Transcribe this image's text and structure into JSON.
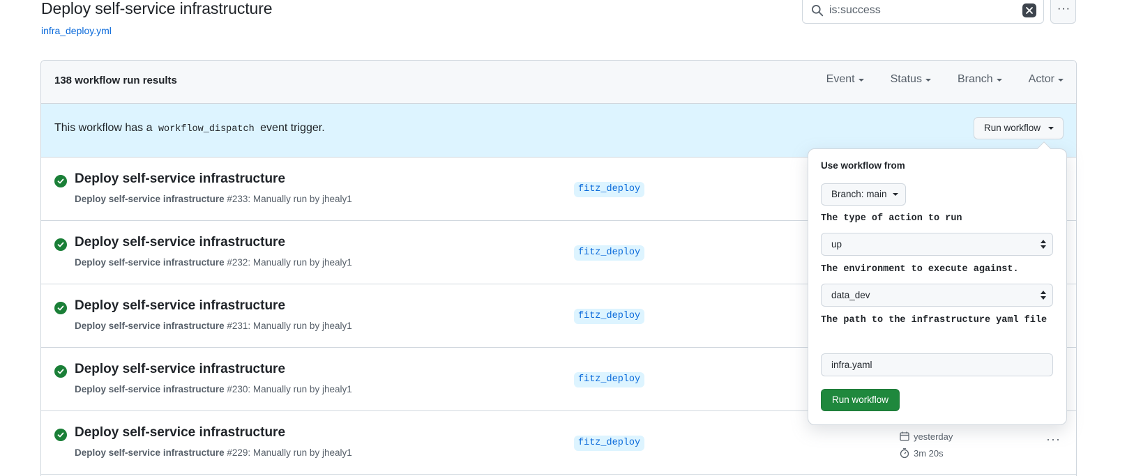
{
  "header": {
    "title": "Deploy self-service infrastructure",
    "file_link": "infra_deploy.yml"
  },
  "search": {
    "value": "is:success",
    "icon": "search-icon",
    "clear_icon": "x-icon"
  },
  "more_menu_label": "···",
  "results": {
    "count_label": "138 workflow run results",
    "filters": [
      "Event",
      "Status",
      "Branch",
      "Actor"
    ]
  },
  "dispatch": {
    "text_before": "This workflow has a",
    "code": "workflow_dispatch",
    "text_after": "event trigger.",
    "run_button": "Run workflow"
  },
  "runs": [
    {
      "title": "Deploy self-service infrastructure",
      "workflow": "Deploy self-service infrastructure",
      "meta": "#233: Manually run by jhealy1",
      "branch": "fitz_deploy"
    },
    {
      "title": "Deploy self-service infrastructure",
      "workflow": "Deploy self-service infrastructure",
      "meta": "#232: Manually run by jhealy1",
      "branch": "fitz_deploy"
    },
    {
      "title": "Deploy self-service infrastructure",
      "workflow": "Deploy self-service infrastructure",
      "meta": "#231: Manually run by jhealy1",
      "branch": "fitz_deploy"
    },
    {
      "title": "Deploy self-service infrastructure",
      "workflow": "Deploy self-service infrastructure",
      "meta": "#230: Manually run by jhealy1",
      "branch": "fitz_deploy"
    },
    {
      "title": "Deploy self-service infrastructure",
      "workflow": "Deploy self-service infrastructure",
      "meta": "#229: Manually run by jhealy1",
      "branch": "fitz_deploy",
      "when": "yesterday",
      "duration": "3m 20s",
      "more": "···"
    }
  ],
  "popover": {
    "use_from_label": "Use workflow from",
    "branch_button": "Branch: main",
    "action_label": "The type of action to run",
    "action_value": "up",
    "env_label": "The environment to execute against.",
    "env_value": "data_dev",
    "path_label": "The path to the infrastructure yaml file",
    "path_value": "infra.yaml",
    "submit": "Run workflow"
  },
  "colors": {
    "success": "#1a7f37",
    "link": "#0969da",
    "banner": "#ddf4ff",
    "primary_button": "#1f883d"
  }
}
